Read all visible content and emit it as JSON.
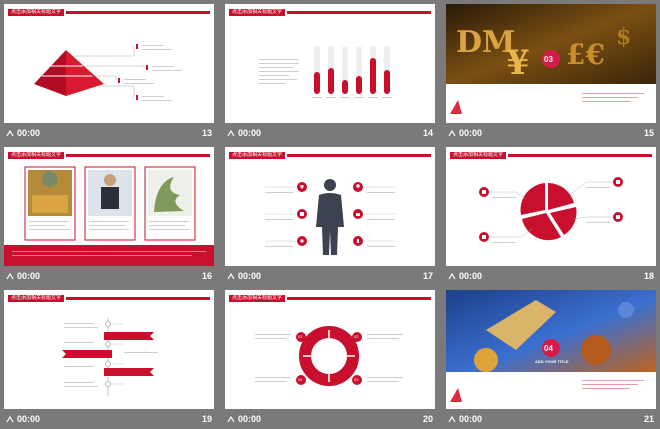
{
  "slides": [
    {
      "num": "13",
      "time": "00:00",
      "title": "点击添加相关标题文字"
    },
    {
      "num": "14",
      "time": "00:00",
      "title": "点击添加相关标题文字"
    },
    {
      "num": "15",
      "time": "00:00",
      "title": "",
      "badge": "03"
    },
    {
      "num": "16",
      "time": "00:00",
      "title": "点击添加相关标题文字"
    },
    {
      "num": "17",
      "time": "00:00",
      "title": "点击添加相关标题文字"
    },
    {
      "num": "18",
      "time": "00:00",
      "title": "点击添加相关标题文字"
    },
    {
      "num": "19",
      "time": "00:00",
      "title": "点击添加相关标题文字"
    },
    {
      "num": "20",
      "time": "00:00",
      "title": "点击添加相关标题文字"
    },
    {
      "num": "21",
      "time": "00:00",
      "title": "",
      "badge": "04",
      "subtitle": "ADD YOUR TITLE"
    }
  ],
  "ring_labels": [
    "01",
    "02",
    "03",
    "04"
  ],
  "colors": {
    "accent": "#c8102e",
    "background": "#7a7a7a"
  }
}
